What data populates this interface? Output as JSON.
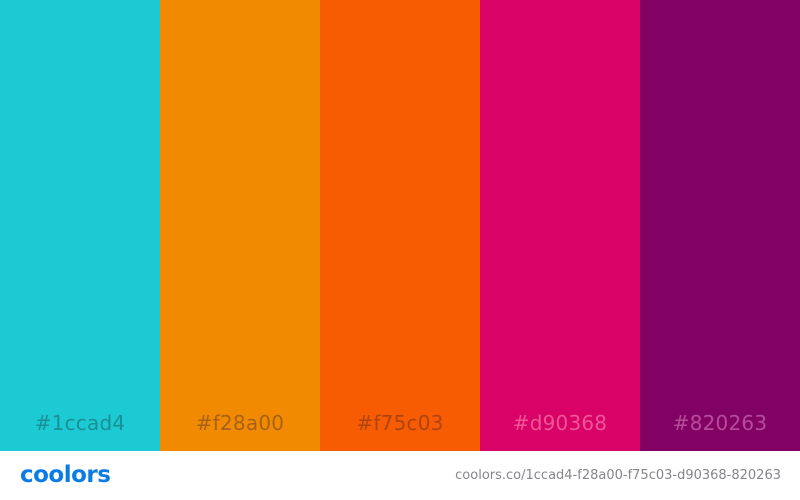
{
  "swatches": [
    {
      "hex": "#1ccad4",
      "color": "#1ccad4",
      "label_color": "#1b8f96"
    },
    {
      "hex": "#f28a00",
      "color": "#f28a00",
      "label_color": "#a8611a"
    },
    {
      "hex": "#f75c03",
      "color": "#f75c03",
      "label_color": "#b0440f"
    },
    {
      "hex": "#d90368",
      "color": "#d90368",
      "label_color": "#f05598"
    },
    {
      "hex": "#820263",
      "color": "#820263",
      "label_color": "#b64b9d"
    }
  ],
  "footer": {
    "brand": "coolors",
    "brand_color": "#0b7be6",
    "url": "coolors.co/1ccad4-f28a00-f75c03-d90368-820263"
  }
}
